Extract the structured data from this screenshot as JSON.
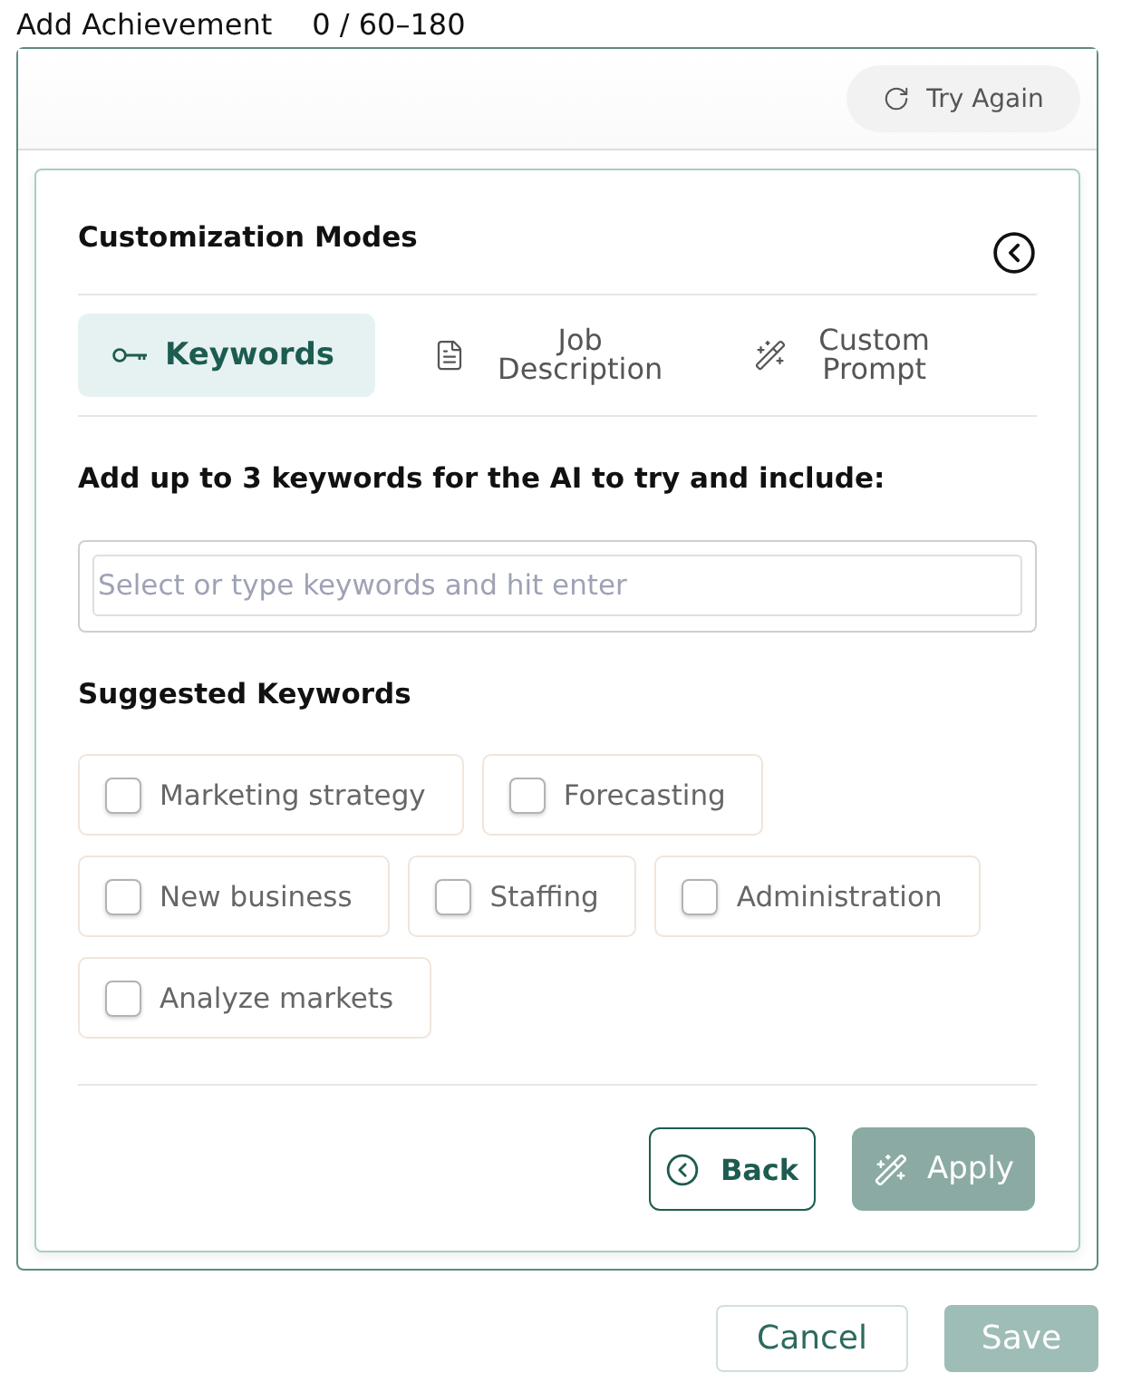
{
  "header": {
    "title": "Add Achievement",
    "counter": "0 / 60–180"
  },
  "try_again_button": {
    "label": "Try Again"
  },
  "panel": {
    "title": "Customization Modes",
    "tabs": [
      {
        "kind": "key",
        "label": "Keywords",
        "selected": true
      },
      {
        "kind": "document",
        "label": "Job Description",
        "selected": false
      },
      {
        "kind": "wand",
        "label": "Custom Prompt",
        "selected": false
      }
    ],
    "instruction": "Add up to 3 keywords for the AI to try and include:",
    "keyword_field": {
      "placeholder": "Select or type keywords and hit enter"
    },
    "suggested_title": "Suggested Keywords",
    "suggestions": [
      {
        "label": "Marketing strategy",
        "checked": false
      },
      {
        "label": "Forecasting",
        "checked": false
      },
      {
        "label": "New business",
        "checked": false
      },
      {
        "label": "Staffing",
        "checked": false
      },
      {
        "label": "Administration",
        "checked": false
      },
      {
        "label": "Analyze markets",
        "checked": false
      }
    ],
    "back_button": {
      "label": "Back"
    },
    "apply_button": {
      "label": "Apply",
      "disabled": true
    }
  },
  "footer": {
    "cancel_button": {
      "label": "Cancel"
    },
    "save_button": {
      "label": "Save",
      "disabled": true
    }
  }
}
